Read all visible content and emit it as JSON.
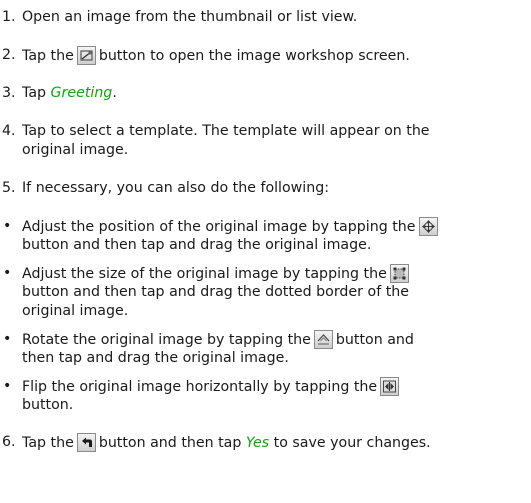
{
  "steps": [
    {
      "num": "1.",
      "text": "Open an image from the thumbnail or list view."
    },
    {
      "num": "2.",
      "pre": "Tap the",
      "icon": "image-workshop-icon",
      "post": "button to open the image workshop screen."
    },
    {
      "num": "3.",
      "pre": "Tap",
      "link": "Greeting",
      "post": "."
    },
    {
      "num": "4.",
      "line1": "Tap to select a template. The template will appear on the",
      "line2": "original image."
    },
    {
      "num": "5.",
      "text": "If necessary, you can also do the following:"
    },
    {
      "num": "6.",
      "pre": "Tap the",
      "icon": "back-arrow-icon",
      "mid": "button and then tap",
      "link": "Yes",
      "post": "to save your changes."
    }
  ],
  "bullets": [
    {
      "line1_pre": "Adjust the position of the original image by tapping the",
      "icon": "move-icon",
      "line2": "button and then tap and drag the original image."
    },
    {
      "line1_pre": "Adjust the size of the original image by tapping the",
      "icon": "resize-icon",
      "line2": "button and then tap and drag the dotted border of the",
      "line3": "original image."
    },
    {
      "line1_pre": "Rotate the original image by tapping the",
      "icon": "rotate-icon",
      "line1_post": "button and",
      "line2": "then tap and drag the original image."
    },
    {
      "line1_pre": "Flip the original image horizontally by tapping the",
      "icon": "flip-icon",
      "line2": "button."
    }
  ],
  "bullet_char": "•"
}
